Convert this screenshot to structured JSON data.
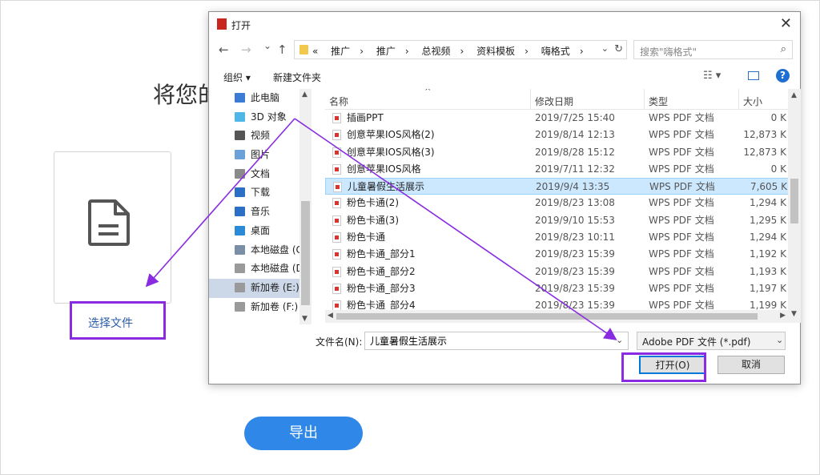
{
  "background": {
    "heading": "将您的",
    "choose_file": "选择文件",
    "export_button": "导出"
  },
  "dialog": {
    "title": "打开",
    "close": "✕",
    "nav": {
      "back": "←",
      "forward": "→",
      "recent": "⌄",
      "up": "↑"
    },
    "address": {
      "prefix": "«",
      "crumbs": [
        "推广",
        "推广",
        "总视频",
        "资料模板",
        "嗨格式"
      ],
      "separator": "›"
    },
    "search_placeholder": "搜索\"嗨格式\"",
    "toolbar": {
      "organize": "组织 ▾",
      "new_folder": "新建文件夹",
      "view_icon": "☷ ▾"
    },
    "nav_pane": [
      {
        "label": "此电脑",
        "icon": "computer-icon",
        "color": "#3a7bd5"
      },
      {
        "label": "3D 对象",
        "icon": "cube-icon",
        "color": "#4fb7e8"
      },
      {
        "label": "视频",
        "icon": "film-icon",
        "color": "#555555"
      },
      {
        "label": "图片",
        "icon": "picture-icon",
        "color": "#6aa1d8"
      },
      {
        "label": "文档",
        "icon": "document-icon",
        "color": "#8a8a8a"
      },
      {
        "label": "下载",
        "icon": "download-icon",
        "color": "#2b6fc7"
      },
      {
        "label": "音乐",
        "icon": "music-icon",
        "color": "#2b6fc7"
      },
      {
        "label": "桌面",
        "icon": "desktop-icon",
        "color": "#2b8ad8"
      },
      {
        "label": "本地磁盘 (C",
        "icon": "drive-icon",
        "color": "#7a8fa6"
      },
      {
        "label": "本地磁盘 (D",
        "icon": "drive-icon",
        "color": "#9a9a9a"
      },
      {
        "label": "新加卷 (E:)",
        "icon": "drive-icon",
        "color": "#9a9a9a"
      },
      {
        "label": "新加卷 (F:)",
        "icon": "drive-icon",
        "color": "#9a9a9a"
      }
    ],
    "columns": {
      "name": "名称",
      "date": "修改日期",
      "type": "类型",
      "size": "大小"
    },
    "files": [
      {
        "name": "插画PPT",
        "date": "2019/7/25 15:40",
        "type": "WPS PDF 文档",
        "size": "0 K"
      },
      {
        "name": "创意苹果IOS风格(2)",
        "date": "2019/8/14 12:13",
        "type": "WPS PDF 文档",
        "size": "12,873 K"
      },
      {
        "name": "创意苹果IOS风格(3)",
        "date": "2019/8/28 15:12",
        "type": "WPS PDF 文档",
        "size": "12,873 K"
      },
      {
        "name": "创意苹果IOS风格",
        "date": "2019/7/11 12:32",
        "type": "WPS PDF 文档",
        "size": "0 K"
      },
      {
        "name": "儿童暑假生活展示",
        "date": "2019/9/4 13:35",
        "type": "WPS PDF 文档",
        "size": "7,605 K"
      },
      {
        "name": "粉色卡通(2)",
        "date": "2019/8/23 13:08",
        "type": "WPS PDF 文档",
        "size": "1,294 K"
      },
      {
        "name": "粉色卡通(3)",
        "date": "2019/9/10 15:53",
        "type": "WPS PDF 文档",
        "size": "1,295 K"
      },
      {
        "name": "粉色卡通",
        "date": "2019/8/23 10:11",
        "type": "WPS PDF 文档",
        "size": "1,294 K"
      },
      {
        "name": "粉色卡通_部分1",
        "date": "2019/8/23 15:39",
        "type": "WPS PDF 文档",
        "size": "1,192 K"
      },
      {
        "name": "粉色卡通_部分2",
        "date": "2019/8/23 15:39",
        "type": "WPS PDF 文档",
        "size": "1,193 K"
      },
      {
        "name": "粉色卡通_部分3",
        "date": "2019/8/23 15:39",
        "type": "WPS PDF 文档",
        "size": "1,197 K"
      },
      {
        "name": "粉色卡通_部分4",
        "date": "2019/8/23 15:39",
        "type": "WPS PDF 文档",
        "size": "1,199 K"
      }
    ],
    "selected_file_index": 4,
    "filename_label": "文件名(N):",
    "filename_value": "儿童暑假生活展示",
    "filetype": "Adobe PDF 文件 (*.pdf)",
    "open_button": "打开(O)",
    "cancel_button": "取消"
  },
  "colors": {
    "annotation": "#8a2be2",
    "accent": "#2f87e8",
    "selection": "#cce8ff"
  }
}
